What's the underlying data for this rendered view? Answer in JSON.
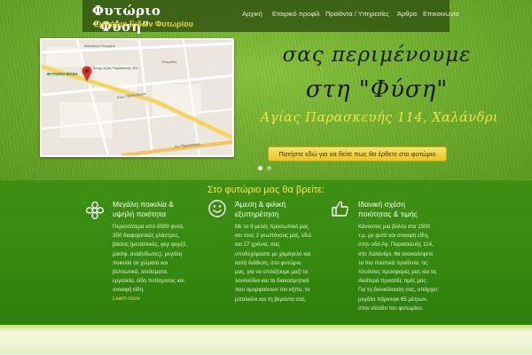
{
  "site": {
    "title": "Φυτώριο “Φύση”",
    "subtitle": "Εμπόριο Ειδών Φυτωρίου"
  },
  "nav": {
    "items": [
      {
        "label": "Αρχική"
      },
      {
        "label": "Εταιρικό προφίλ"
      },
      {
        "label": "Προϊόντα / Υπηρεσίες"
      },
      {
        "label": "Άρθρα"
      },
      {
        "label": "Επικοινωνία"
      }
    ]
  },
  "slider": {
    "line1": "σας περιμένουμε",
    "line2": "στη \"Φύση\"",
    "line3": "Αγίας Παρασκευής 114, Χαλάνδρι",
    "cta_label": "Πατήστε εδώ για να δείτε πως θα έρθετε στο φυτώριο",
    "slides": 2,
    "active_slide": 1,
    "map": {
      "marker_label": "ΦΥΤΩΡΙΟ ΦΥΣΗ",
      "marker_detail": "Λεωφ. Αγίας Παρασκευής 114",
      "streets": [
        "Βασιλέως Γεωργίου",
        "Ολυμπίας",
        "Κων. Παλαιολόγου",
        "Αγ. Παρασκευής"
      ]
    }
  },
  "features": {
    "section_title": "Στο φυτώριο μας θα βρείτε:",
    "items": [
      {
        "icon": "flower-icon",
        "title_lines": [
          "Μεγάλη ποικιλία &",
          "υψηλή ποιότητα"
        ],
        "body_lines": [
          "Περισσότερα από 6500 φυτά,",
          "350 διαφορετικές γλάστρες,",
          "βάσεις (μεταλλικές, φερ φορζέ,",
          "μασίφ, αναξείδωτες), μεγάλη",
          "ποικιλία σε χώματα και",
          "βελτιωτικά, λιπάσματα,",
          "εργαλεία, είδη ποτίσματος και",
          "συναφή είδη."
        ],
        "link": "Learn more"
      },
      {
        "icon": "smiley-icon",
        "title_lines": [
          "Άμεση & φιλική",
          "εξυπηρέτηση"
        ],
        "body_lines": [
          "Με το 9 μελές προσωπικό μας",
          "και τους 2 γεωπόνους μας, εδώ",
          "και 27 χρόνια, σας",
          "υποδεχόμαστε με χαμόγελο και",
          "καλή διάθεση, στο φυτώριο",
          "μας, για να επιλέξουμε μαζί τα",
          "λουλούδια και τα διακοσμητικά",
          "που ομορφαίνουν τον κήπο, το",
          "μπαλκόνι και τη βεράντα σας."
        ]
      },
      {
        "icon": "thumbs-up-icon",
        "title_lines": [
          "Ιδανική σχέση",
          "ποιότητας & τιμής"
        ],
        "body_lines": [
          "Κάνοντας μια βόλτα στα 1500",
          "τ.μ. με φυτά και συναφή είδη,",
          "στην οδό Αγ. Παρασκευής 114,",
          "στο Χαλάνδρι, θα ανακαλύψετε",
          "τα πιο ποιοτικά προϊόντα, τις",
          "πλούσιες προσφορές μας και τις",
          "ιδιαίτερα προσιτές τιμές μας.",
          "Για τη διευκόλυνση σας, υπάρχει",
          "μεγάλο πάρκινγκ 65 μέτρων,",
          "στην είσοδο του φυτωρίου."
        ]
      }
    ]
  },
  "colors": {
    "accent_yellow": "#ffe34a",
    "content_green": "#368a10",
    "header_bg": "#28460c"
  }
}
